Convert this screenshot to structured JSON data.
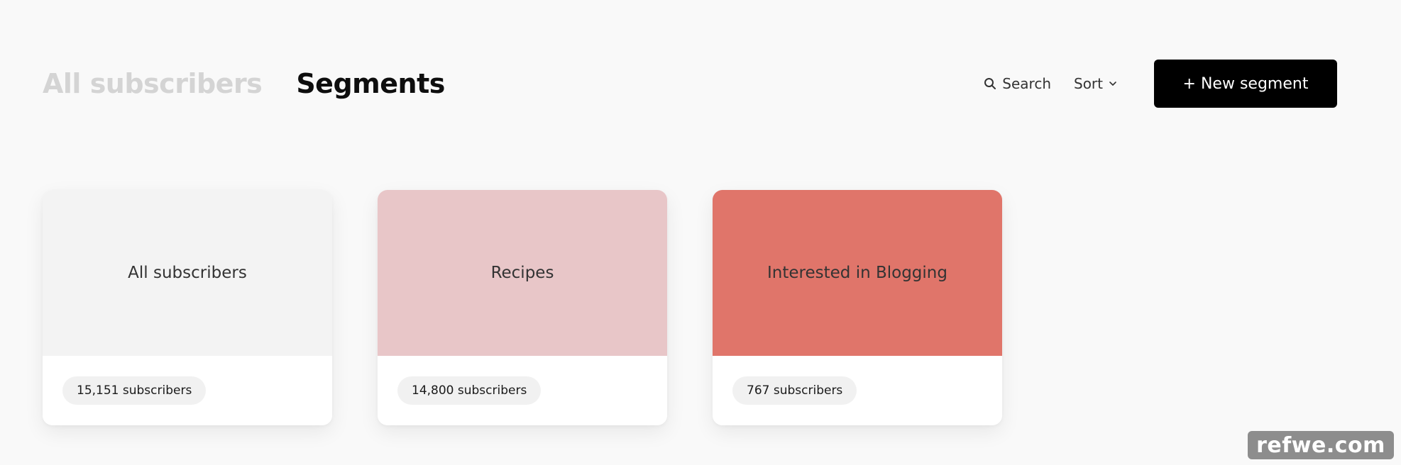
{
  "tabs": [
    {
      "label": "All subscribers",
      "active": false
    },
    {
      "label": "Segments",
      "active": true
    }
  ],
  "actions": {
    "search_label": "Search",
    "sort_label": "Sort",
    "new_segment_label": "+ New segment"
  },
  "segments": [
    {
      "title": "All subscribers",
      "count": "15,151 subscribers",
      "color": "#f3f3f3"
    },
    {
      "title": "Recipes",
      "count": "14,800 subscribers",
      "color": "#e8c6c8"
    },
    {
      "title": "Interested in Blogging",
      "count": "767 subscribers",
      "color": "#e0756a"
    }
  ],
  "watermark": "refwe.com"
}
